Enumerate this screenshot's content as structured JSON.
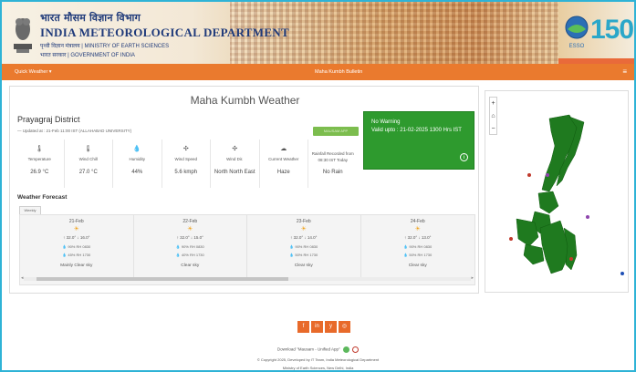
{
  "header": {
    "hindi_title": "भारत मौसम विज्ञान विभाग",
    "title": "INDIA METEOROLOGICAL DEPARTMENT",
    "sub1": "पृथ्वी विज्ञान मंत्रालय | MINISTRY OF EARTH SCIENCES",
    "sub2": "भारत सरकार | GOVERNMENT OF INDIA",
    "anniversary": "150",
    "esso_label": "ESSO"
  },
  "nav": {
    "quick_weather": "Quick Weather ▾",
    "bulletin": "Maha Kumbh Bulletin",
    "menu_icon": "≡"
  },
  "page": {
    "title": "Maha Kumbh Weather",
    "district": "Prayagraj District",
    "updated": "— Updated at : 21-Feb 11:00 IST (ALLAHABAD UNIVERSITY)",
    "download_button": "MAUSAM APP"
  },
  "warning": {
    "line1": "No Warning",
    "line2": "Valid upto : 21-02-2025 1300 Hrs IST",
    "info_icon": "i",
    "color": "#2e9a2e"
  },
  "params": [
    {
      "icon": "🌡",
      "label": "Temperature",
      "value": "26.9 °C"
    },
    {
      "icon": "🌡",
      "label": "Wind Chill",
      "value": "27.0 °C"
    },
    {
      "icon": "💧",
      "label": "Humidity",
      "value": "44%"
    },
    {
      "icon": "✣",
      "label": "Wind Speed",
      "value": "5.6 kmph"
    },
    {
      "icon": "✣",
      "label": "Wind Dir.",
      "value": "North North East"
    },
    {
      "icon": "☁",
      "label": "Current Weather",
      "value": "Haze"
    },
    {
      "icon": "",
      "label": "Rainfall Recorded from 08:30 IST Today",
      "value": "No Rain"
    }
  ],
  "forecast": {
    "title": "Weather Forecast",
    "tab": "Weekly",
    "days": [
      {
        "date": "21-Feb",
        "temp": "↑ 32.0° ↓ 16.0°",
        "rh1": "💧 90% RH 0830",
        "rh2": "💧 45% RH 1730",
        "condition": "Mainly Clear sky"
      },
      {
        "date": "22-Feb",
        "temp": "↑ 32.0° ↓ 15.0°",
        "rh1": "💧 90% RH 0830",
        "rh2": "💧 40% RH 1730",
        "condition": "Clear sky"
      },
      {
        "date": "23-Feb",
        "temp": "↑ 32.0° ↓ 14.0°",
        "rh1": "💧 90% RH 0830",
        "rh2": "💧 50% RH 1730",
        "condition": "Clear sky"
      },
      {
        "date": "24-Feb",
        "temp": "↑ 32.0° ↓ 13.0°",
        "rh1": "💧 90% RH 0830",
        "rh2": "💧 50% RH 1730",
        "condition": "Clear sky"
      }
    ]
  },
  "map": {
    "zoom_in": "+",
    "home": "⌂",
    "zoom_out": "−"
  },
  "footer": {
    "social": [
      "f",
      "in",
      "y",
      "◎"
    ],
    "download": "Download \"Mausam - Unified App\"",
    "copyright": "© Copyright 2025, Developed by IT Team, India Meteorological Department",
    "ministry": "Ministry of Earth Sciences, New Delhi, India"
  }
}
